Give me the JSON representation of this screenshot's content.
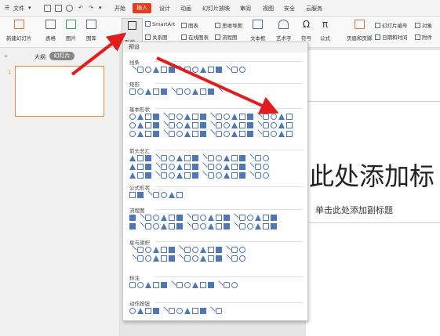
{
  "menubar": {
    "file": "文件",
    "tabs": [
      "开始",
      "插入",
      "设计",
      "动画",
      "幻灯片放映",
      "审阅",
      "视图",
      "安全",
      "云服务"
    ],
    "active_tab": "插入",
    "accent": "#e23d1f"
  },
  "ribbon": {
    "new_slide": "新建幻灯片",
    "table": "表格",
    "picture": "图片",
    "gallery": "图库",
    "shape": "形状",
    "smartart": "SmartArt",
    "chart": "图表",
    "relation": "关系图",
    "online_chart": "在线图表",
    "mindmap": "思维导图",
    "flowchart": "流程图",
    "textbox": "文本框",
    "wordart": "艺术字",
    "symbol": "符号",
    "formula": "公式",
    "header_footer": "页眉和页脚",
    "slide_number": "幻灯片编号",
    "datetime": "日期和时间",
    "object": "对象",
    "attachment": "附件"
  },
  "left_panel": {
    "outline_tab": "大纲",
    "slides_tab": "幻灯片",
    "slide_index": "1"
  },
  "slide": {
    "title": "此处添加标",
    "subtitle": "单击此处添加副标题"
  },
  "shape_menu": {
    "preset": "预设",
    "categories": [
      "线条",
      "矩形",
      "基本形状",
      "箭头总汇",
      "公式形状",
      "流程图",
      "星与旗帜",
      "标注",
      "动作按钮"
    ]
  }
}
